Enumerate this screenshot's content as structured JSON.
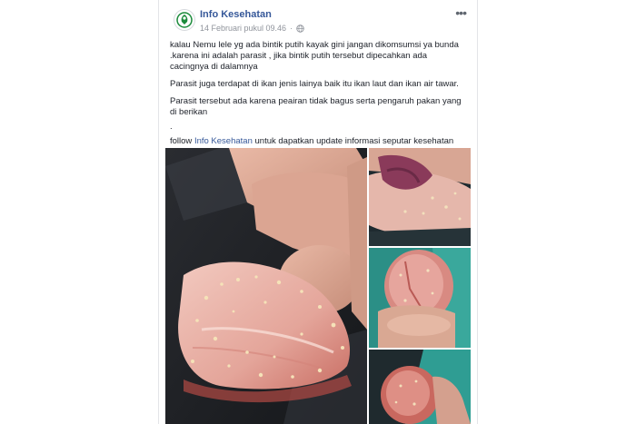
{
  "post": {
    "page_name": "Info Kesehatan",
    "timestamp": "14 Februari pukul 09.46",
    "privacy_icon": "globe-icon",
    "more_icon": "more-options-icon",
    "paragraph_1": "kalau Nemu lele yg ada bintik putih kayak gini jangan dikomsumsi ya bunda .karena ini adalah parasit , jika bintik putih tersebut dipecahkan ada cacingnya di dalamnya",
    "paragraph_2": "Parasit juga terdapat di ikan jenis lainya baik itu ikan laut dan ikan air tawar.",
    "paragraph_3": "Parasit tersebut ada karena peairan tidak bagus serta pengaruh pakan yang di berikan",
    "separator": ".",
    "follow_prefix": "follow ",
    "follow_link": "Info Kesehatan",
    "follow_suffix": " untuk dapatkan update informasi seputar kesehatan"
  },
  "colors": {
    "link": "#365899",
    "text": "#1d2129",
    "meta": "#90949c"
  }
}
